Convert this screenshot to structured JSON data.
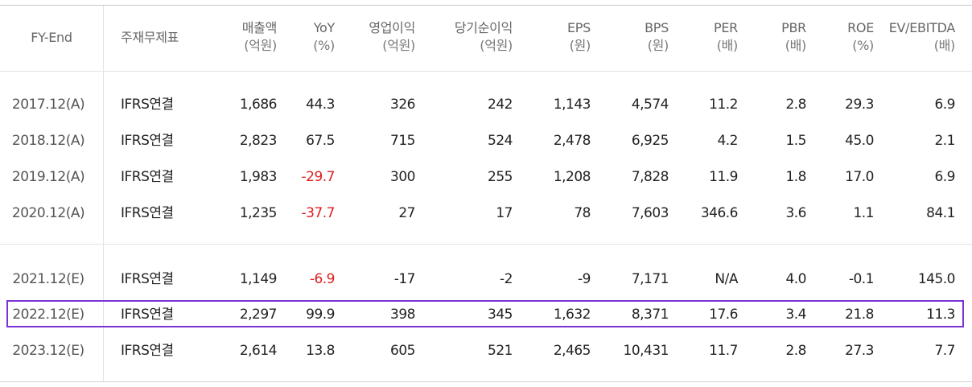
{
  "headers": [
    {
      "line1": "FY-End",
      "line2": ""
    },
    {
      "line1": "주재무제표",
      "line2": ""
    },
    {
      "line1": "매출액",
      "line2": "(억원)"
    },
    {
      "line1": "YoY",
      "line2": "(%)"
    },
    {
      "line1": "영업이익",
      "line2": "(억원)"
    },
    {
      "line1": "당기순이익",
      "line2": "(억원)"
    },
    {
      "line1": "EPS",
      "line2": "(원)"
    },
    {
      "line1": "BPS",
      "line2": "(원)"
    },
    {
      "line1": "PER",
      "line2": "(배)"
    },
    {
      "line1": "PBR",
      "line2": "(배)"
    },
    {
      "line1": "ROE",
      "line2": "(%)"
    },
    {
      "line1": "EV/EBITDA",
      "line2": "(배)"
    }
  ],
  "rows": [
    [
      "2017.12(A)",
      "IFRS연결",
      "1,686",
      "44.3",
      "326",
      "242",
      "1,143",
      "4,574",
      "11.2",
      "2.8",
      "29.3",
      "6.9"
    ],
    [
      "2018.12(A)",
      "IFRS연결",
      "2,823",
      "67.5",
      "715",
      "524",
      "2,478",
      "6,925",
      "4.2",
      "1.5",
      "45.0",
      "2.1"
    ],
    [
      "2019.12(A)",
      "IFRS연결",
      "1,983",
      "-29.7",
      "300",
      "255",
      "1,208",
      "7,828",
      "11.9",
      "1.8",
      "17.0",
      "6.9"
    ],
    [
      "2020.12(A)",
      "IFRS연결",
      "1,235",
      "-37.7",
      "27",
      "17",
      "78",
      "7,603",
      "346.6",
      "3.6",
      "1.1",
      "84.1"
    ],
    [
      "2021.12(E)",
      "IFRS연결",
      "1,149",
      "-6.9",
      "-17",
      "-2",
      "-9",
      "7,171",
      "N/A",
      "4.0",
      "-0.1",
      "145.0"
    ],
    [
      "2022.12(E)",
      "IFRS연결",
      "2,297",
      "99.9",
      "398",
      "345",
      "1,632",
      "8,371",
      "17.6",
      "3.4",
      "21.8",
      "11.3"
    ],
    [
      "2023.12(E)",
      "IFRS연결",
      "2,614",
      "13.8",
      "605",
      "521",
      "2,465",
      "10,431",
      "11.7",
      "2.8",
      "27.3",
      "7.7"
    ]
  ],
  "highlighted_row": "2022.12(E)",
  "colors": {
    "negative_yoy": "#e01e1e",
    "highlight_border": "#7a33d6"
  }
}
